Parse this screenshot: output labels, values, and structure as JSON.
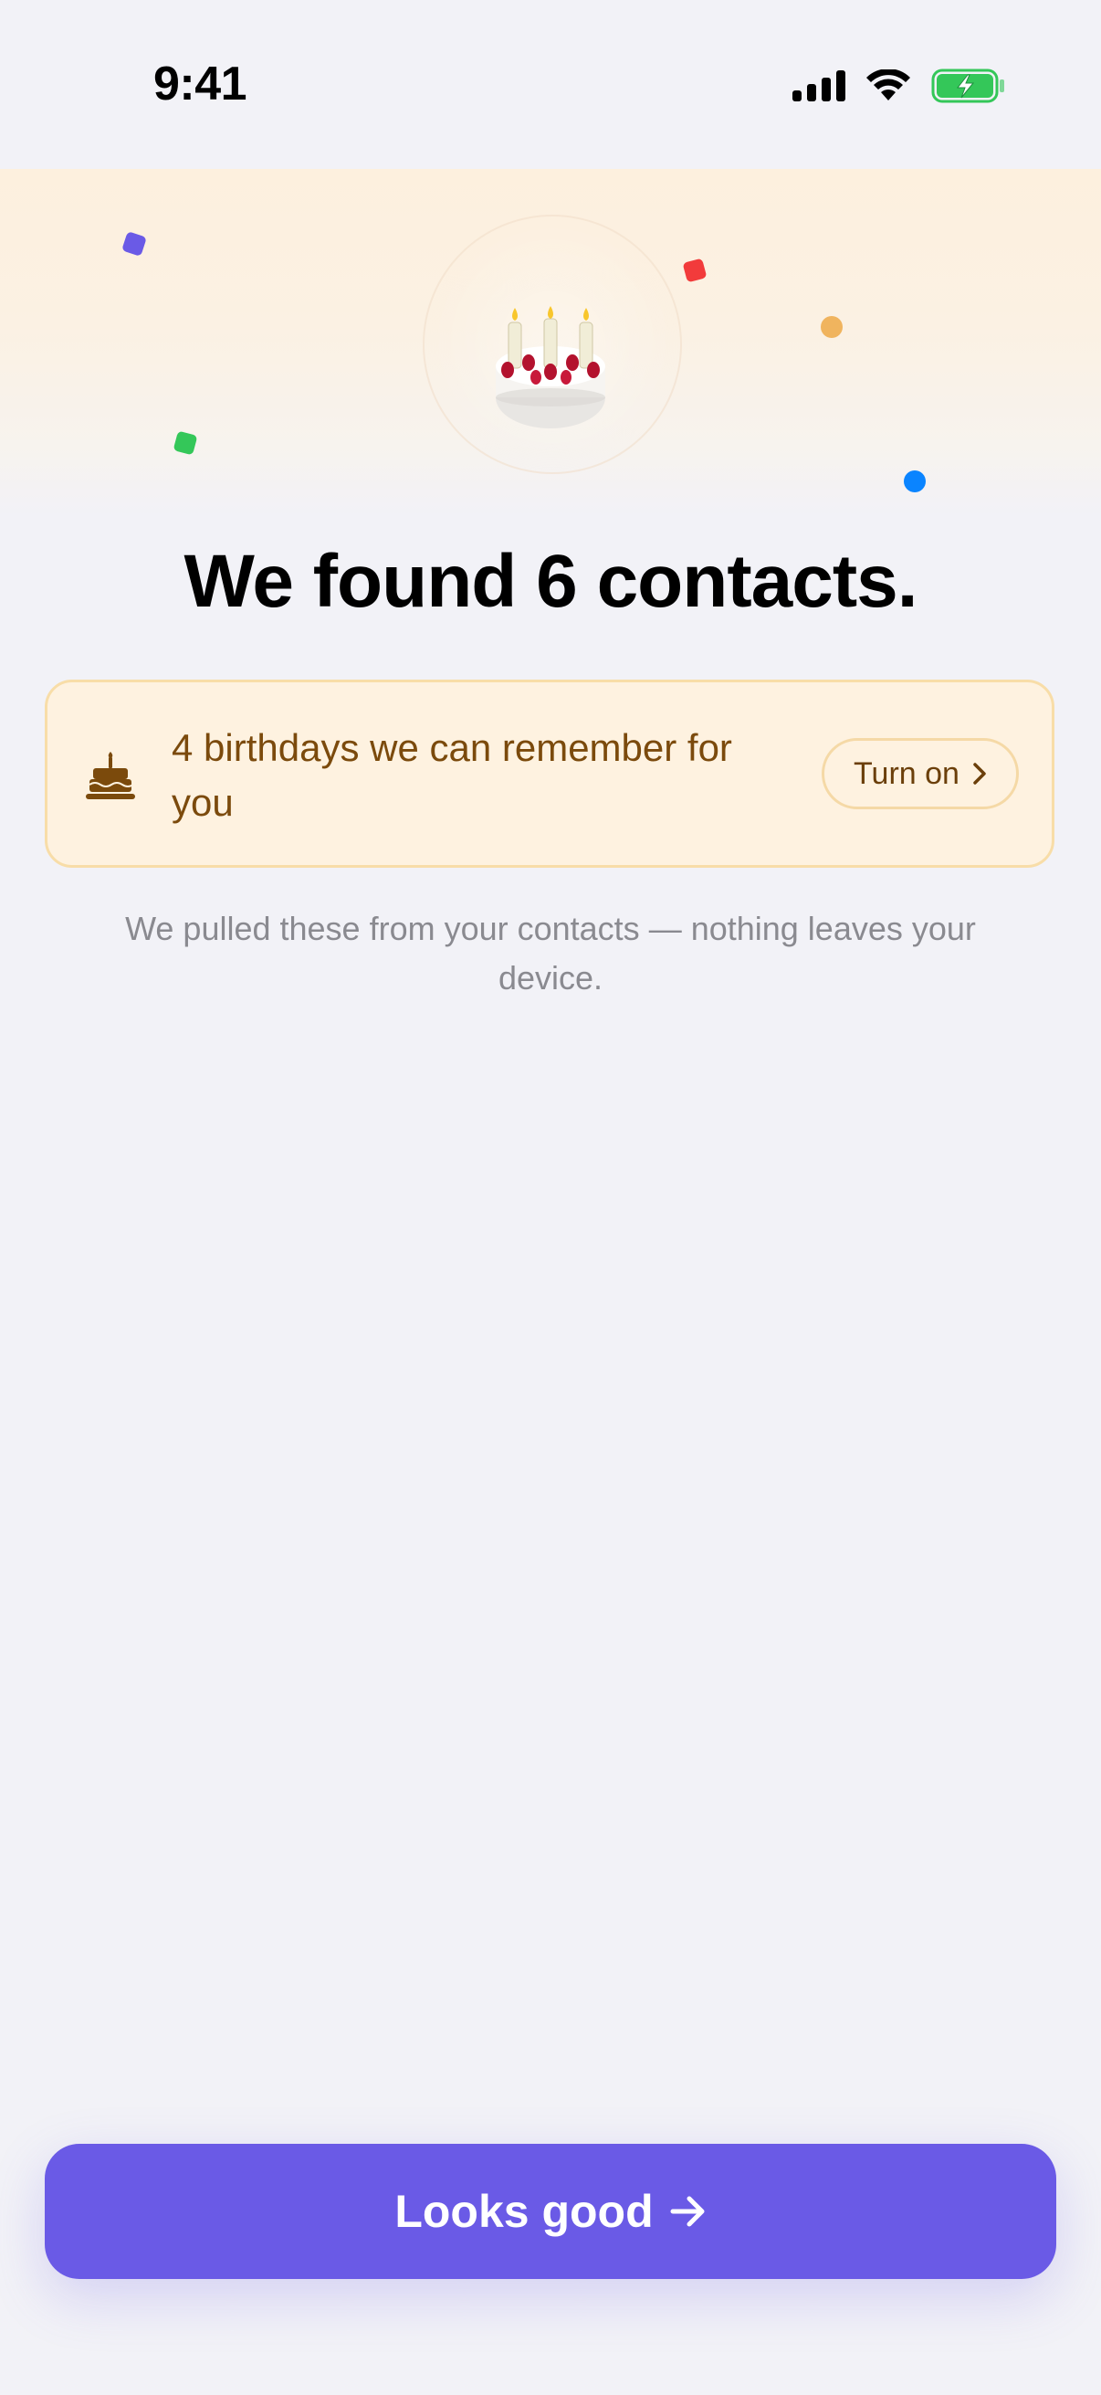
{
  "status_bar": {
    "time": "9:41",
    "icons": [
      "cellular-signal-icon",
      "wifi-icon",
      "battery-charging-icon"
    ]
  },
  "hero": {
    "icon": "birthday-cake-icon",
    "confetti_colors": [
      "#6A5AE6",
      "#F23B3B",
      "#F0B45E",
      "#34C759",
      "#0A84FF"
    ]
  },
  "title": "We found 6 contacts.",
  "banner": {
    "icon": "birthday-cake-icon",
    "text": "4 birthdays we can remember for you",
    "button_label": "Turn on",
    "button_icon": "chevron-right-icon"
  },
  "subtitle": "We pulled these from your contacts — nothing leaves your device.",
  "primary_button": {
    "label": "Looks good",
    "icon": "arrow-right-icon"
  },
  "colors": {
    "accent": "#6A5AE6",
    "banner_bg": "#FEF2E0",
    "banner_border": "#F8DDA8",
    "banner_text": "#7B4A0C",
    "background": "#F2F2F7",
    "battery_green": "#34C759"
  }
}
